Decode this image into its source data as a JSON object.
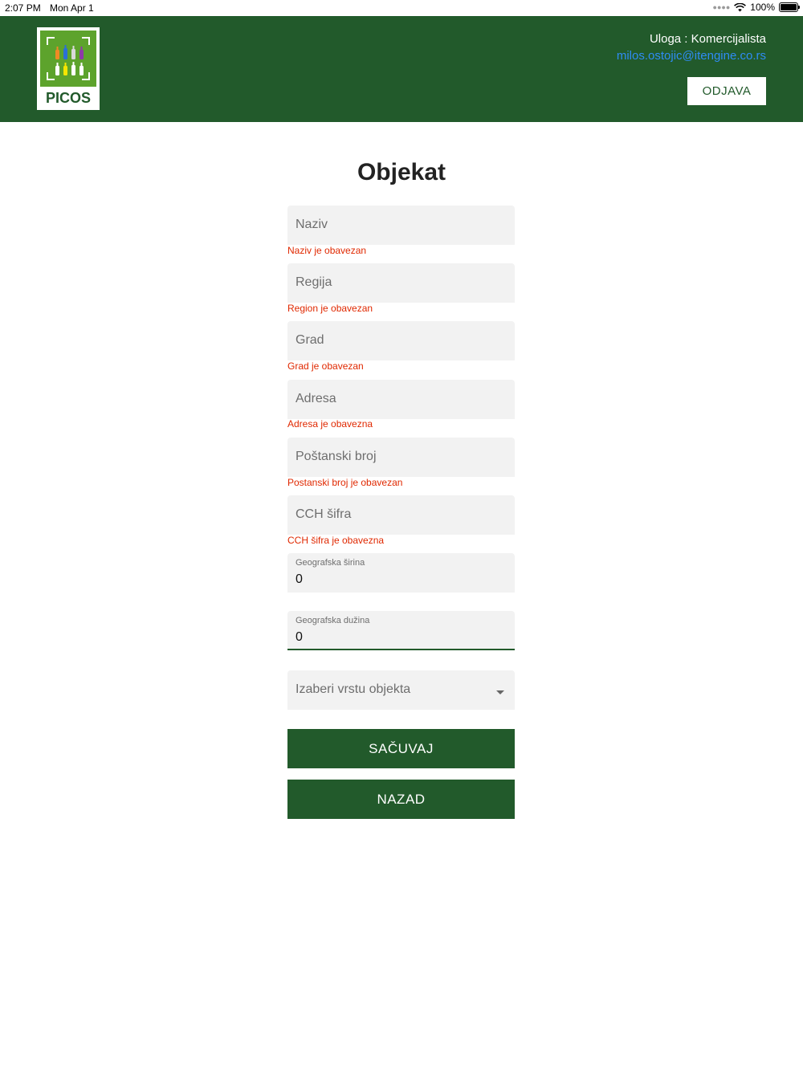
{
  "status_bar": {
    "time": "2:07 PM",
    "date": "Mon Apr 1",
    "battery": "100%"
  },
  "header": {
    "logo_text": "PICOS",
    "role": "Uloga : Komercijalista",
    "email": "milos.ostojic@itengine.co.rs",
    "logout_label": "ODJAVA"
  },
  "form": {
    "title": "Objekat",
    "naziv": {
      "placeholder": "Naziv",
      "error": "Naziv je obavezan"
    },
    "regija": {
      "placeholder": "Regija",
      "error": "Region je obavezan"
    },
    "grad": {
      "placeholder": "Grad",
      "error": "Grad je obavezan"
    },
    "adresa": {
      "placeholder": "Adresa",
      "error": "Adresa je obavezna"
    },
    "postanski_broj": {
      "placeholder": "Poštanski broj",
      "error": "Postanski broj je obavezan"
    },
    "cch_sifra": {
      "placeholder": "CCH šifra",
      "error": "CCH šifra je obavezna"
    },
    "geo_sirina": {
      "label": "Geografska širina",
      "value": "0"
    },
    "geo_duzina": {
      "label": "Geografska dužina",
      "value": "0"
    },
    "vrsta_objekta": {
      "placeholder": "Izaberi vrstu objekta"
    },
    "save_label": "SAČUVAJ",
    "back_label": "NAZAD"
  },
  "colors": {
    "brand_green": "#225a2b",
    "logo_green": "#5da32c",
    "error_red": "#e02800",
    "link_blue": "#2f8cf5"
  }
}
